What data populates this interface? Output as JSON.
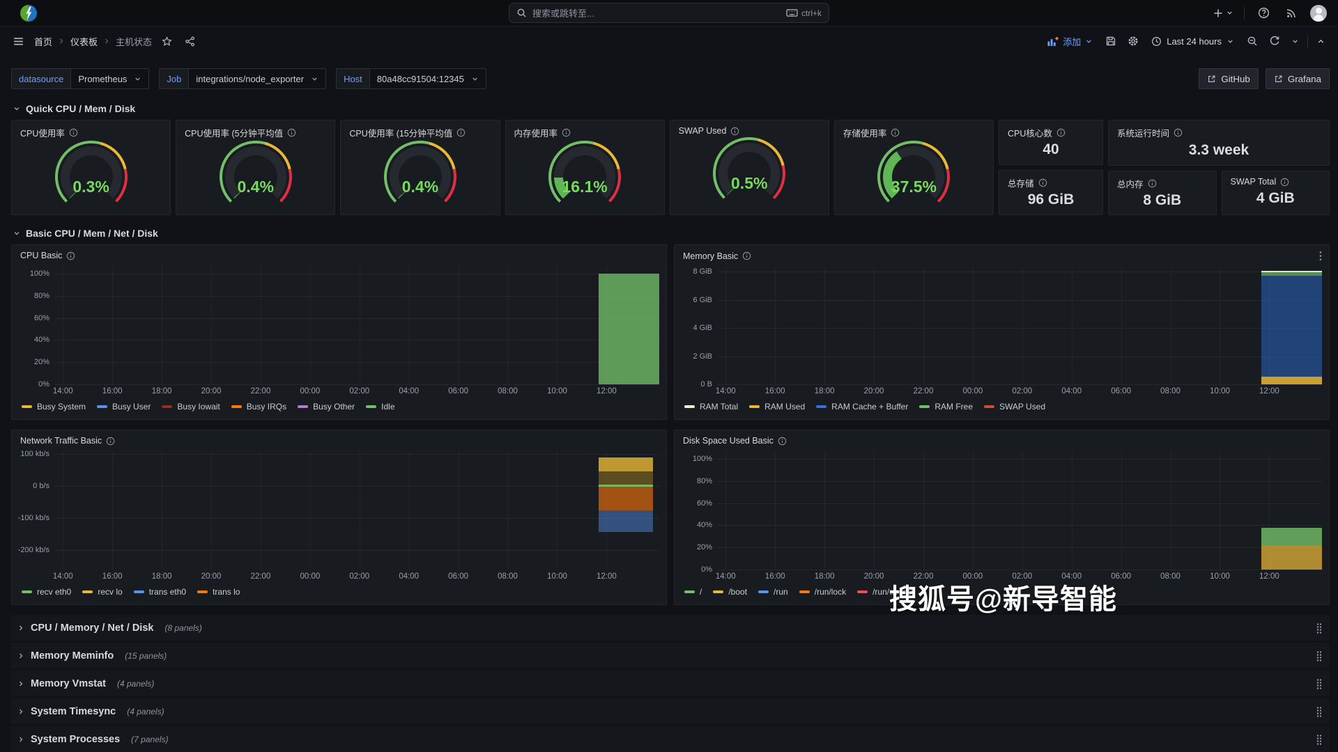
{
  "colors": {
    "background": "#111217",
    "panel": "#181b1f",
    "accent_blue": "#6e9fff",
    "green": "#73bf69",
    "yellow": "#eab839",
    "blue": "#5794f2",
    "orange": "#ff780a",
    "red": "#e02f44",
    "purple": "#b877d9",
    "dark_red": "#962d22",
    "cream": "#e0f9d7",
    "gauge_value_text": "#78da60"
  },
  "topnav": {
    "search": {
      "placeholder": "搜索或跳转至...",
      "shortcut": "ctrl+k"
    }
  },
  "toolbar": {
    "breadcrumb": [
      "首页",
      "仪表板",
      "主机状态"
    ],
    "add_label": "添加",
    "time_range": "Last 24 hours"
  },
  "filters": {
    "vars": [
      {
        "label": "datasource",
        "value": "Prometheus"
      },
      {
        "label": "Job",
        "value": "integrations/node_exporter"
      },
      {
        "label": "Host",
        "value": "80a48cc91504:12345"
      }
    ],
    "links": [
      {
        "label": "GitHub"
      },
      {
        "label": "Grafana"
      }
    ]
  },
  "sections": {
    "quick": "Quick CPU / Mem / Disk",
    "basic": "Basic CPU / Mem / Net / Disk"
  },
  "gauges": [
    {
      "title": "CPU使用率",
      "value": "0.3%",
      "pct": 0.3
    },
    {
      "title": "CPU使用率 (5分钟平均值",
      "value": "0.4%",
      "pct": 0.4
    },
    {
      "title": "CPU使用率 (15分钟平均值",
      "value": "0.4%",
      "pct": 0.4
    },
    {
      "title": "内存使用率",
      "value": "16.1%",
      "pct": 16.1
    },
    {
      "title": "SWAP Used",
      "value": "0.5%",
      "pct": 0.5
    },
    {
      "title": "存储使用率",
      "value": "37.5%",
      "pct": 37.5
    }
  ],
  "stats": [
    {
      "title": "CPU核心数",
      "value": "40"
    },
    {
      "title": "系统运行时间",
      "value": "3.3 week"
    },
    {
      "title": "总存储",
      "value": "96 GiB"
    },
    {
      "title": "总内存",
      "value": "8 GiB"
    },
    {
      "title": "SWAP Total",
      "value": "4 GiB"
    }
  ],
  "charts": [
    {
      "title": "CPU Basic",
      "type": "area",
      "panel_menu": false,
      "x_ticks": [
        "14:00",
        "16:00",
        "18:00",
        "20:00",
        "22:00",
        "00:00",
        "02:00",
        "04:00",
        "06:00",
        "08:00",
        "10:00",
        "12:00"
      ],
      "y_ticks": [
        {
          "label": "100%",
          "v": 100
        },
        {
          "label": "80%",
          "v": 80
        },
        {
          "label": "60%",
          "v": 60
        },
        {
          "label": "40%",
          "v": 40
        },
        {
          "label": "20%",
          "v": 20
        },
        {
          "label": "0%",
          "v": 0
        }
      ],
      "ylim": [
        0,
        107
      ],
      "legend": [
        {
          "label": "Busy System",
          "color": "#eab839"
        },
        {
          "label": "Busy User",
          "color": "#5794f2"
        },
        {
          "label": "Busy Iowait",
          "color": "#962d22"
        },
        {
          "label": "Busy IRQs",
          "color": "#ff780a"
        },
        {
          "label": "Busy Other",
          "color": "#b877d9"
        },
        {
          "label": "Idle",
          "color": "#73bf69"
        }
      ],
      "bands": [
        {
          "series": "Idle",
          "x0": 0.9,
          "x1": 1.0,
          "v0": 0,
          "v1": 100,
          "color": "#73bf69",
          "alpha": 0.78,
          "edge": true
        }
      ],
      "data_note": "Idle ≈ 100% from ~11:40 to ~13:00, no data before"
    },
    {
      "title": "Memory Basic",
      "type": "area",
      "panel_menu": true,
      "x_ticks": [
        "14:00",
        "16:00",
        "18:00",
        "20:00",
        "22:00",
        "00:00",
        "02:00",
        "04:00",
        "06:00",
        "08:00",
        "10:00",
        "12:00"
      ],
      "y_ticks": [
        {
          "label": "8 GiB",
          "v": 8
        },
        {
          "label": "6 GiB",
          "v": 6
        },
        {
          "label": "4 GiB",
          "v": 4
        },
        {
          "label": "2 GiB",
          "v": 2
        },
        {
          "label": "0 B",
          "v": 0
        }
      ],
      "ylim": [
        0,
        8.35
      ],
      "legend": [
        {
          "label": "RAM Total",
          "color": "#e0f9d7"
        },
        {
          "label": "RAM Used",
          "color": "#eab839"
        },
        {
          "label": "RAM Cache + Buffer",
          "color": "#3274d9"
        },
        {
          "label": "RAM Free",
          "color": "#73bf69"
        },
        {
          "label": "SWAP Used",
          "color": "#d44a3a"
        }
      ],
      "bands": [
        {
          "series": "RAM Used",
          "x0": 0.9,
          "x1": 1.0,
          "v0": 0,
          "v1": 0.55,
          "color": "#eab839",
          "alpha": 0.85,
          "edge": true
        },
        {
          "series": "RAM Cache + Buffer",
          "x0": 0.9,
          "x1": 1.0,
          "v0": 0.55,
          "v1": 7.72,
          "color": "#2a5fb0",
          "alpha": 0.6,
          "edge": false
        },
        {
          "series": "RAM Free",
          "x0": 0.9,
          "x1": 1.0,
          "v0": 7.72,
          "v1": 7.95,
          "color": "#73bf69",
          "alpha": 0.7,
          "edge": false
        },
        {
          "series": "RAM Total",
          "x0": 0.9,
          "x1": 1.0,
          "v0": 7.93,
          "v1": 8.03,
          "color": "#e0f9d7",
          "alpha": 0.95,
          "edge": false
        }
      ],
      "data_note": "RAM Total 8 GiB; mostly cache+buffer; visible only ~11:40-13:00"
    },
    {
      "title": "Network Traffic Basic",
      "type": "area",
      "panel_menu": false,
      "x_ticks": [
        "14:00",
        "16:00",
        "18:00",
        "20:00",
        "22:00",
        "00:00",
        "02:00",
        "04:00",
        "06:00",
        "08:00",
        "10:00",
        "12:00"
      ],
      "y_ticks": [
        {
          "label": "100 kb/s",
          "v": 100
        },
        {
          "label": "0 b/s",
          "v": 0
        },
        {
          "label": "-100 kb/s",
          "v": -100
        },
        {
          "label": "-200 kb/s",
          "v": -200
        }
      ],
      "ylim": [
        -262,
        108
      ],
      "legend": [
        {
          "label": "recv eth0",
          "color": "#73bf69"
        },
        {
          "label": "recv lo",
          "color": "#eab839"
        },
        {
          "label": "trans eth0",
          "color": "#5794f2"
        },
        {
          "label": "trans lo",
          "color": "#ff780a"
        }
      ],
      "bands": [
        {
          "series": "recv lo",
          "x0": 0.9,
          "x1": 0.99,
          "v0": 45,
          "v1": 88,
          "color": "#eab839",
          "alpha": 0.8,
          "edge": true
        },
        {
          "series": "recv lo",
          "x0": 0.9,
          "x1": 0.99,
          "v0": 0,
          "v1": 45,
          "color": "#b08a1e",
          "alpha": 0.45,
          "edge": false
        },
        {
          "series": "trans lo",
          "x0": 0.9,
          "x1": 0.99,
          "v0": -78,
          "v1": 0,
          "color": "#ff780a",
          "alpha": 0.6,
          "edge": false
        },
        {
          "series": "trans eth0",
          "x0": 0.9,
          "x1": 0.99,
          "v0": -145,
          "v1": -78,
          "color": "#5794f2",
          "alpha": 0.45,
          "edge": false
        },
        {
          "series": "recv eth0",
          "x0": 0.9,
          "x1": 0.99,
          "v0": -3,
          "v1": 3,
          "color": "#73bf69",
          "alpha": 0.95,
          "edge": false
        }
      ],
      "data_note": "recv lo ≈ +90 kb/s, trans lo ≈ -95 kb/s, trans eth0 ≈ -150 kb/s near 12:00"
    },
    {
      "title": "Disk Space Used Basic",
      "type": "area",
      "panel_menu": false,
      "x_ticks": [
        "14:00",
        "16:00",
        "18:00",
        "20:00",
        "22:00",
        "00:00",
        "02:00",
        "04:00",
        "06:00",
        "08:00",
        "10:00",
        "12:00"
      ],
      "y_ticks": [
        {
          "label": "100%",
          "v": 100
        },
        {
          "label": "80%",
          "v": 80
        },
        {
          "label": "60%",
          "v": 60
        },
        {
          "label": "40%",
          "v": 40
        },
        {
          "label": "20%",
          "v": 20
        },
        {
          "label": "0%",
          "v": 0
        }
      ],
      "ylim": [
        0,
        107
      ],
      "legend": [
        {
          "label": "/",
          "color": "#73bf69"
        },
        {
          "label": "/boot",
          "color": "#eab839"
        },
        {
          "label": "/run",
          "color": "#5794f2"
        },
        {
          "label": "/run/lock",
          "color": "#ff780a"
        },
        {
          "label": "/run/user/0",
          "color": "#f2495c"
        }
      ],
      "bands": [
        {
          "series": "/",
          "x0": 0.9,
          "x1": 1.0,
          "v0": 22,
          "v1": 38,
          "color": "#73bf69",
          "alpha": 0.8,
          "edge": true
        },
        {
          "series": "/boot",
          "x0": 0.9,
          "x1": 1.0,
          "v0": 0,
          "v1": 22,
          "color": "#eab839",
          "alpha": 0.72,
          "edge": true
        }
      ],
      "data_note": "/ ≈ 38%, /boot ≈ 22% visible ~11:40-13:00"
    }
  ],
  "collapsed_rows": [
    {
      "title": "CPU / Memory / Net / Disk",
      "count": "(8 panels)"
    },
    {
      "title": "Memory Meminfo",
      "count": "(15 panels)"
    },
    {
      "title": "Memory Vmstat",
      "count": "(4 panels)"
    },
    {
      "title": "System Timesync",
      "count": "(4 panels)"
    },
    {
      "title": "System Processes",
      "count": "(7 panels)"
    }
  ],
  "watermark": "搜狐号@新导智能"
}
